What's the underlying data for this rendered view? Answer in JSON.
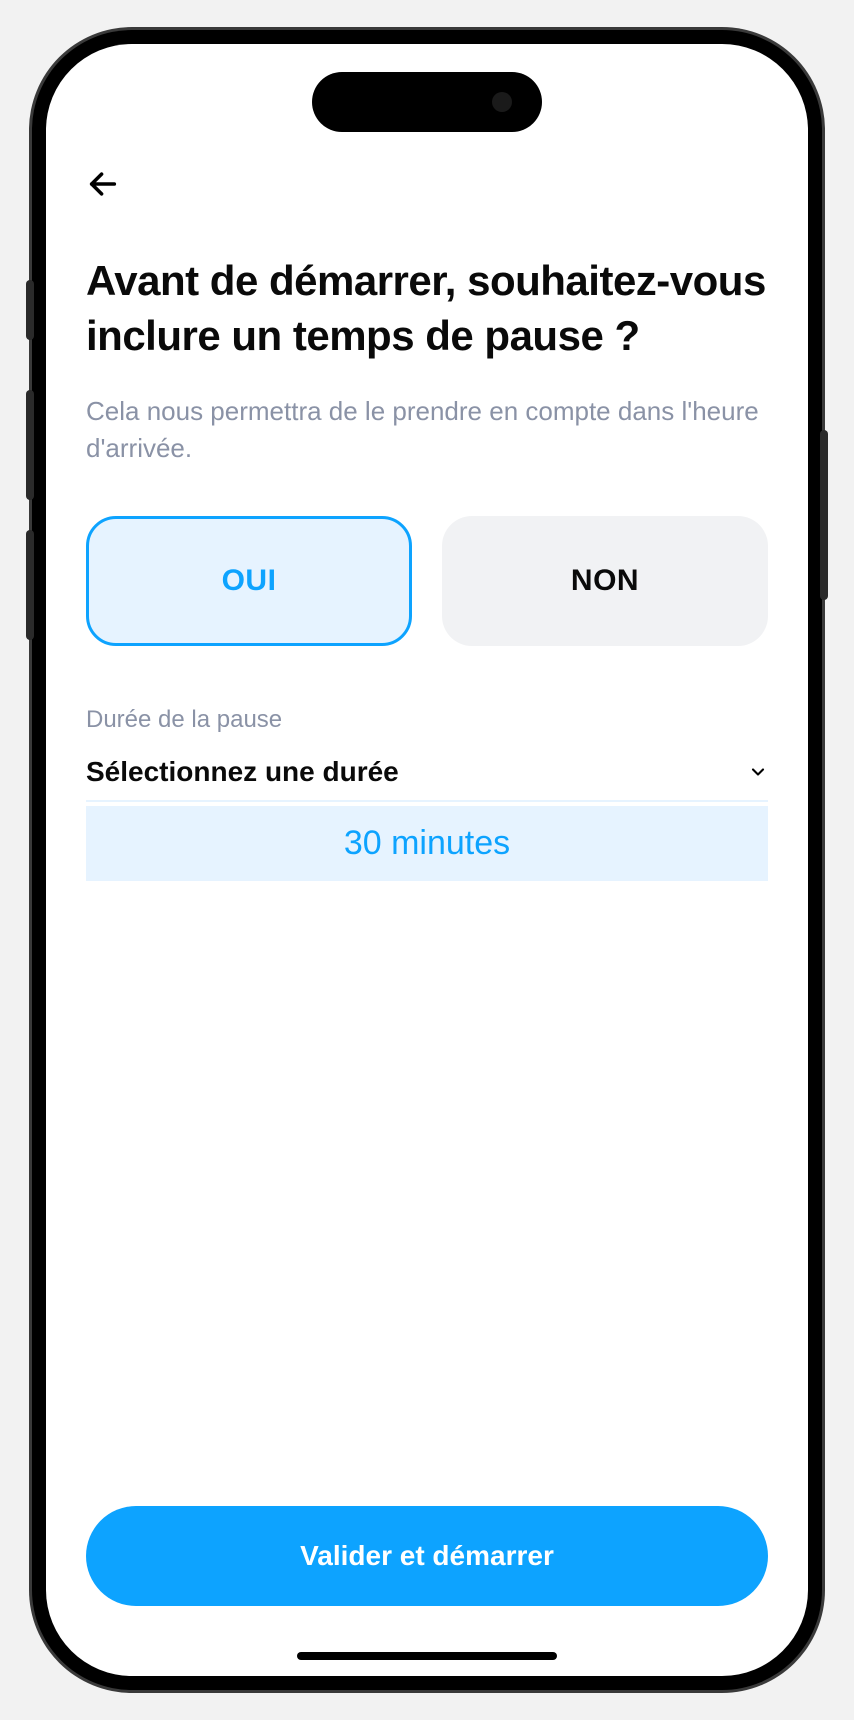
{
  "header": {
    "title": "Avant de démarrer, souhaitez-vous inclure un temps de pause ?",
    "subtitle": "Cela nous permettra de le prendre en compte dans l'heure d'arrivée."
  },
  "options": {
    "yes": "OUI",
    "no": "NON"
  },
  "duration": {
    "label": "Durée de la pause",
    "placeholder": "Sélectionnez une durée",
    "selected": "30 minutes"
  },
  "cta": {
    "primary": "Valider et démarrer"
  },
  "colors": {
    "accent": "#0da3ff",
    "accentLight": "#e6f3ff",
    "muted": "#8a92a6",
    "neutral": "#f1f2f4"
  }
}
